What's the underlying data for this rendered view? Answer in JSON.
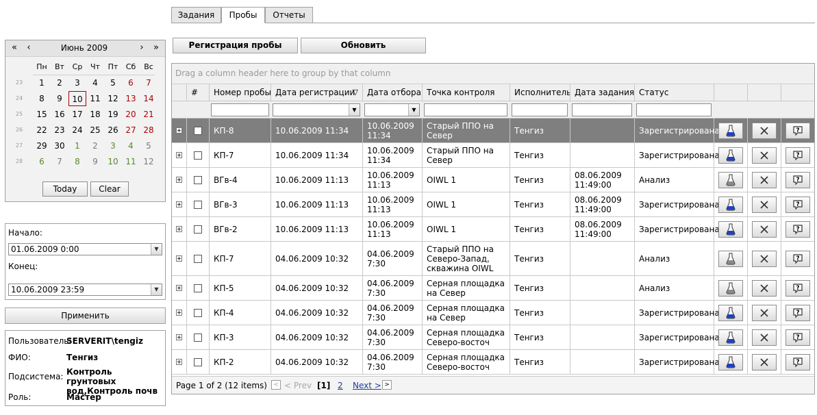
{
  "tabs": [
    {
      "label": "Задания"
    },
    {
      "label": "Пробы"
    },
    {
      "label": "Отчеты"
    }
  ],
  "calendar": {
    "month_title": "Июнь 2009",
    "nav_prev_year": "«",
    "nav_prev_month": "‹",
    "nav_next_month": "›",
    "nav_next_year": "»",
    "weekdays": [
      "Пн",
      "Вт",
      "Ср",
      "Чт",
      "Пт",
      "Сб",
      "Вс"
    ],
    "weeks": [
      {
        "num": "23",
        "days": [
          "1",
          "2",
          "3",
          "4",
          "5",
          "6",
          "7"
        ]
      },
      {
        "num": "24",
        "days": [
          "8",
          "9",
          "10",
          "11",
          "12",
          "13",
          "14"
        ]
      },
      {
        "num": "25",
        "days": [
          "15",
          "16",
          "17",
          "18",
          "19",
          "20",
          "21"
        ]
      },
      {
        "num": "26",
        "days": [
          "22",
          "23",
          "24",
          "25",
          "26",
          "27",
          "28"
        ]
      },
      {
        "num": "27",
        "days": [
          "29",
          "30",
          "1",
          "2",
          "3",
          "4",
          "5"
        ]
      },
      {
        "num": "28",
        "days": [
          "6",
          "7",
          "8",
          "9",
          "10",
          "11",
          "12"
        ]
      }
    ],
    "today_btn": "Today",
    "clear_btn": "Clear",
    "weekend_color": "#b00000",
    "highlighted_day": "10"
  },
  "range": {
    "start_label": "Начало:",
    "start_value": "01.06.2009 0:00",
    "end_label": "Конец:",
    "end_value": "10.06.2009 23:59",
    "apply_btn": "Применить"
  },
  "user": {
    "user_label": "Пользователь:",
    "user_value": "SERVERIT\\tengiz",
    "fio_label": "ФИО:",
    "fio_value": "Тенгиз",
    "subsystem_label": "Подсистема:",
    "subsystem_value": "Контроль грунтовых вод,Контроль почв",
    "role_label": "Роль:",
    "role_value": "Мастер"
  },
  "toolbar": {
    "register_btn": "Регистрация пробы",
    "refresh_btn": "Обновить"
  },
  "grid": {
    "group_hint": "Drag a column header here to group by that column",
    "columns": [
      "#",
      "Номер пробы",
      "Дата регистрации",
      "Дата отбора",
      "Точка контроля",
      "Исполнитель",
      "Дата задания",
      "Статус"
    ],
    "sort_indicator": "▽",
    "rows": [
      {
        "num": "КП-8",
        "reg": "10.06.2009 11:34",
        "sample": "10.06.2009 11:34",
        "point": "Старый ППО на Север",
        "exec": "Тенгиз",
        "task": "",
        "status": "Зарегистрирована",
        "selected": true,
        "flask": "blue"
      },
      {
        "num": "КП-7",
        "reg": "10.06.2009 11:34",
        "sample": "10.06.2009 11:34",
        "point": "Старый ППО на Север",
        "exec": "Тенгиз",
        "task": "",
        "status": "Зарегистрирована",
        "selected": false,
        "flask": "blue"
      },
      {
        "num": "ВГв-4",
        "reg": "10.06.2009 11:13",
        "sample": "10.06.2009 11:13",
        "point": "OIWL 1",
        "exec": "Тенгиз",
        "task": "08.06.2009 11:49:00",
        "status": "Анализ",
        "selected": false,
        "flask": "gray"
      },
      {
        "num": "ВГв-3",
        "reg": "10.06.2009 11:13",
        "sample": "10.06.2009 11:13",
        "point": "OIWL 1",
        "exec": "Тенгиз",
        "task": "08.06.2009 11:49:00",
        "status": "Зарегистрирована",
        "selected": false,
        "flask": "blue"
      },
      {
        "num": "ВГв-2",
        "reg": "10.06.2009 11:13",
        "sample": "10.06.2009 11:13",
        "point": "OIWL 1",
        "exec": "Тенгиз",
        "task": "08.06.2009 11:49:00",
        "status": "Зарегистрирована",
        "selected": false,
        "flask": "blue"
      },
      {
        "num": "КП-7",
        "reg": "04.06.2009 10:32",
        "sample": "04.06.2009 7:30",
        "point": "Старый ППО на Северо-Запад, скважина OIWL",
        "exec": "Тенгиз",
        "task": "",
        "status": "Анализ",
        "selected": false,
        "flask": "gray"
      },
      {
        "num": "КП-5",
        "reg": "04.06.2009 10:32",
        "sample": "04.06.2009 7:30",
        "point": "Серная площадка на Север",
        "exec": "Тенгиз",
        "task": "",
        "status": "Анализ",
        "selected": false,
        "flask": "gray"
      },
      {
        "num": "КП-4",
        "reg": "04.06.2009 10:32",
        "sample": "04.06.2009 7:30",
        "point": "Серная площадка на Север",
        "exec": "Тенгиз",
        "task": "",
        "status": "Зарегистрирована",
        "selected": false,
        "flask": "blue"
      },
      {
        "num": "КП-3",
        "reg": "04.06.2009 10:32",
        "sample": "04.06.2009 7:30",
        "point": "Серная площадка Северо-восточ",
        "exec": "Тенгиз",
        "task": "",
        "status": "Зарегистрирована",
        "selected": false,
        "flask": "blue"
      },
      {
        "num": "КП-2",
        "reg": "04.06.2009 10:32",
        "sample": "04.06.2009 7:30",
        "point": "Серная площадка Северо-восточ",
        "exec": "Тенгиз",
        "task": "",
        "status": "Зарегистрирована",
        "selected": false,
        "flask": "blue"
      }
    ]
  },
  "pager": {
    "summary": "Page 1 of 2 (12 items)",
    "prev_arrow": "<",
    "prev_label": "< Prev",
    "current_page": "[1]",
    "page2": "2",
    "next_label": "Next >",
    "next_arrow": ">"
  },
  "colors": {
    "selected_row": "#7f7f7f",
    "flask_blue": "#2040c8",
    "link": "#1a3c9a"
  }
}
